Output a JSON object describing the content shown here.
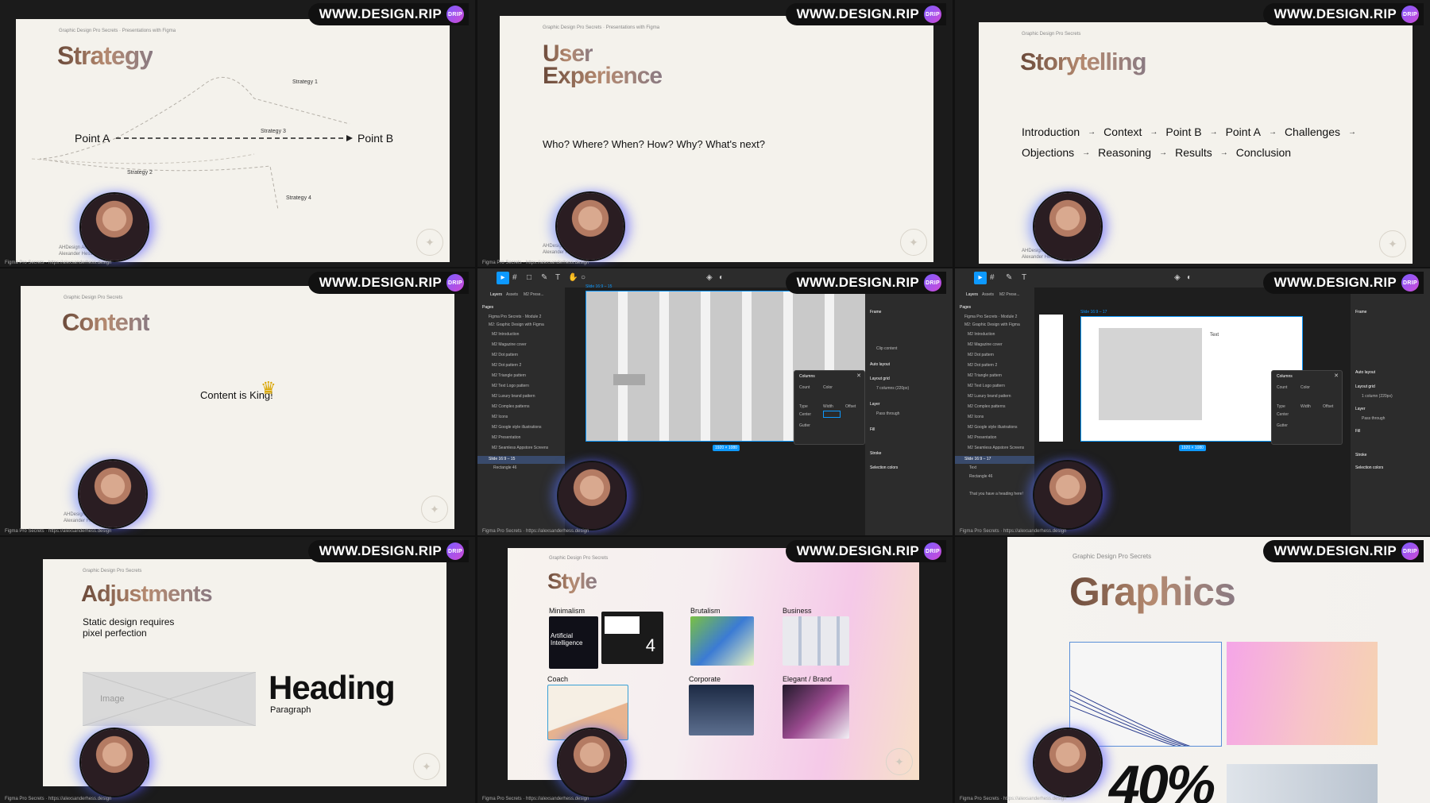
{
  "watermark": "WWW.DESIGN.RIP",
  "watermark_badge": "DRIP",
  "series": "Graphic Design Pro Secrets",
  "course": "Graphic Design Pro Secrets · Presentations with Figma",
  "footer": "Figma Pro Secrets · https://alexsanderhess.design",
  "author_line1": "AHDesign Academy",
  "author_line2": "Alexander Hess",
  "slides": {
    "strategy": {
      "title": "Strategy",
      "point_a": "Point A",
      "point_b": "Point B",
      "labels": [
        "Strategy 1",
        "Strategy 2",
        "Strategy 3",
        "Strategy 4"
      ]
    },
    "ux": {
      "title_line1": "User",
      "title_line2": "Experience",
      "questions": "Who? Where? When? How? Why? What's next?"
    },
    "storytelling": {
      "title": "Storytelling",
      "row1": [
        "Introduction",
        "Context",
        "Point B",
        "Point A",
        "Challenges"
      ],
      "row2": [
        "Objections",
        "Reasoning",
        "Results",
        "Conclusion"
      ]
    },
    "content": {
      "title": "Content",
      "tagline": "Content is King!"
    },
    "adjustments": {
      "title": "Adjustments",
      "subtitle_line1": "Static design requires",
      "subtitle_line2": "pixel perfection",
      "image_label": "Image",
      "heading": "Heading",
      "paragraph": "Paragraph"
    },
    "style": {
      "title": "Style",
      "categories": [
        "Minimalism",
        "Brutalism",
        "Business",
        "Coach",
        "Corporate",
        "Elegant / Brand"
      ],
      "thumb_text_1": "Artificial Intelligence",
      "thumb_text_2": "4"
    },
    "graphics": {
      "title": "Graphics",
      "big_number": "40%"
    }
  },
  "figma": {
    "tabs": [
      "Layers",
      "Assets",
      "M2 Prese..."
    ],
    "pages_label": "Pages",
    "pages": [
      "Figma Pro Secrets · Module 2",
      "M2: Graphic Design with Figma"
    ],
    "layers": [
      "M2 Introduction",
      "M2 Magazine cover",
      "M2 Dot pattern",
      "M2 Dot pattern 2",
      "M2 Triangle pattern",
      "M2 Text Logo pattern",
      "M2 Luxury brand pattern",
      "M2 Complex patterns",
      "M2 Icons",
      "M2 Google style illustrations",
      "M2 Presentation",
      "M2 Seamless Appstore Screens"
    ],
    "frame_a": "Slide 16:9 – 15",
    "frame_b": "Slide 16:9 – 17",
    "frame_label_a": "Slide 16:9 – 15",
    "frame_label_b": "Slide 16:9 – 17",
    "size_badge": "1920 × 1080",
    "columns_panel": "Columns",
    "count": "Count",
    "color": "Color",
    "type": "Type",
    "width": "Width",
    "offset": "Offset",
    "gutter": "Gutter",
    "center": "Center",
    "frame": "Frame",
    "layout_grid": "Layout grid",
    "auto_layout": "Auto layout",
    "layer": "Layer",
    "fill": "Fill",
    "stroke": "Stroke",
    "selection_colors": "Selection colors",
    "pass_through": "Pass through",
    "clip_content": "Clip content",
    "columns_value": "7 columns (220px)",
    "columns_value_b": "1 column (220px)",
    "text_layer": "Text",
    "rect_layer": "Rectangle 46",
    "hint": "That you have a heading here!"
  }
}
